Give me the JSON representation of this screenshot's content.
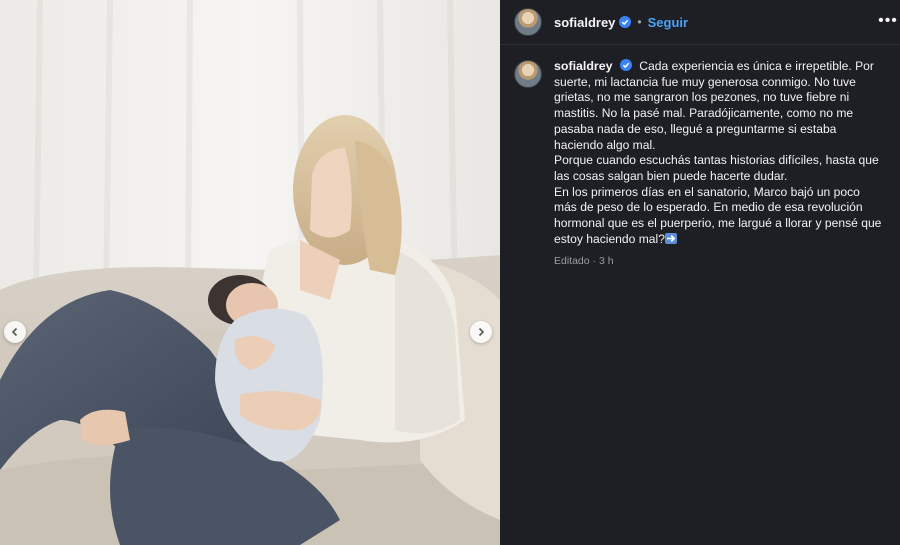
{
  "post": {
    "image_alt_icon": "photo",
    "carousel": {
      "prev_icon": "chevron-left-icon",
      "next_icon": "chevron-right-icon"
    }
  },
  "header": {
    "username": "sofialdrey",
    "separator": "•",
    "follow_label": "Seguir",
    "more_label": "•••"
  },
  "caption": {
    "username": "sofialdrey",
    "line1": "Cada experiencia es única e irrepetible. Por suerte, mi lactancia fue muy generosa conmigo. No tuve grietas, no me sangraron los pezones, no tuve fiebre ni mastitis. No la pasé mal. Paradójicamente, como no me pasaba nada de eso, llegué a preguntarme si estaba haciendo algo mal.",
    "line2": "Porque cuando escuchás tantas historias difíciles, hasta que las cosas salgan bien puede hacerte dudar.",
    "line3": "En los primeros días en el sanatorio, Marco bajó un poco más de peso de lo esperado. En medio de esa revolución hormonal que es el puerperio, me largué a llorar y pensé que estoy haciendo mal?",
    "emoji": "arrow-right-emoji",
    "meta": "Editado · 3 h"
  },
  "colors": {
    "background": "#1d1f24",
    "accent": "#4aa3f7",
    "verified": "#3b82f6",
    "muted": "#9a9ca3"
  }
}
